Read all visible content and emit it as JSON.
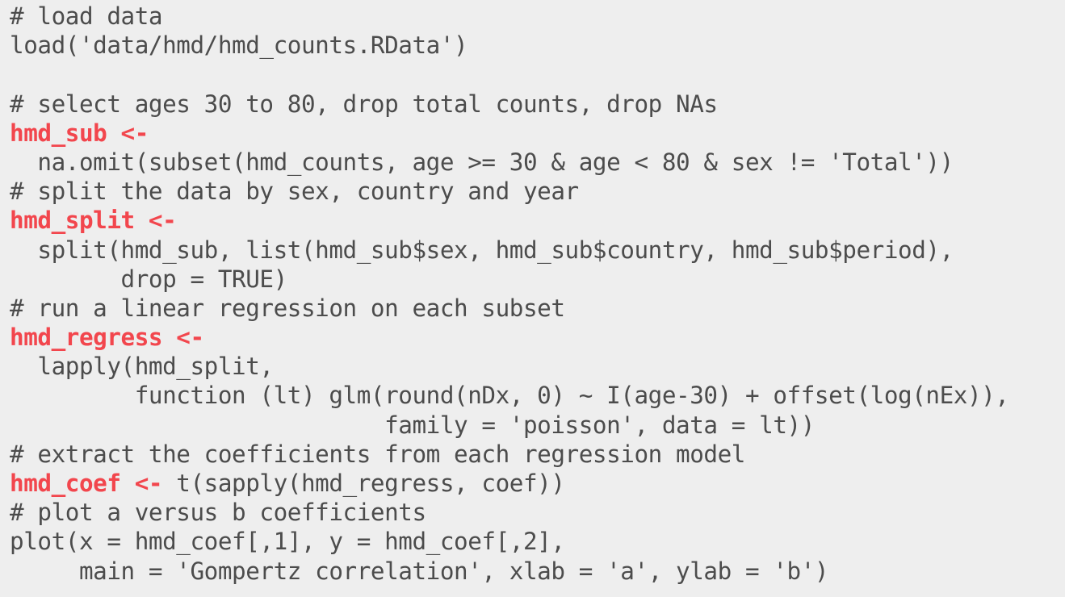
{
  "theme": {
    "background": "#eeeeee",
    "text_color": "#4c4c4c",
    "highlight_color": "#f2464d"
  },
  "code": {
    "lines": [
      {
        "hl": "",
        "text": "# load data"
      },
      {
        "hl": "",
        "text": "load('data/hmd/hmd_counts.RData')"
      },
      {
        "hl": "",
        "text": ""
      },
      {
        "hl": "",
        "text": "# select ages 30 to 80, drop total counts, drop NAs"
      },
      {
        "hl": "hmd_sub <-",
        "text": ""
      },
      {
        "hl": "",
        "text": "  na.omit(subset(hmd_counts, age >= 30 & age < 80 & sex != 'Total'))"
      },
      {
        "hl": "",
        "text": "# split the data by sex, country and year"
      },
      {
        "hl": "hmd_split <-",
        "text": ""
      },
      {
        "hl": "",
        "text": "  split(hmd_sub, list(hmd_sub$sex, hmd_sub$country, hmd_sub$period),"
      },
      {
        "hl": "",
        "text": "        drop = TRUE)"
      },
      {
        "hl": "",
        "text": "# run a linear regression on each subset"
      },
      {
        "hl": "hmd_regress <-",
        "text": ""
      },
      {
        "hl": "",
        "text": "  lapply(hmd_split,"
      },
      {
        "hl": "",
        "text": "         function (lt) glm(round(nDx, 0) ~ I(age-30) + offset(log(nEx)),"
      },
      {
        "hl": "",
        "text": "                           family = 'poisson', data = lt))"
      },
      {
        "hl": "",
        "text": "# extract the coefficients from each regression model"
      },
      {
        "hl": "hmd_coef <-",
        "text": " t(sapply(hmd_regress, coef))"
      },
      {
        "hl": "",
        "text": "# plot a versus b coefficients"
      },
      {
        "hl": "",
        "text": "plot(x = hmd_coef[,1], y = hmd_coef[,2],"
      },
      {
        "hl": "",
        "text": "     main = 'Gompertz correlation', xlab = 'a', ylab = 'b')"
      }
    ]
  }
}
